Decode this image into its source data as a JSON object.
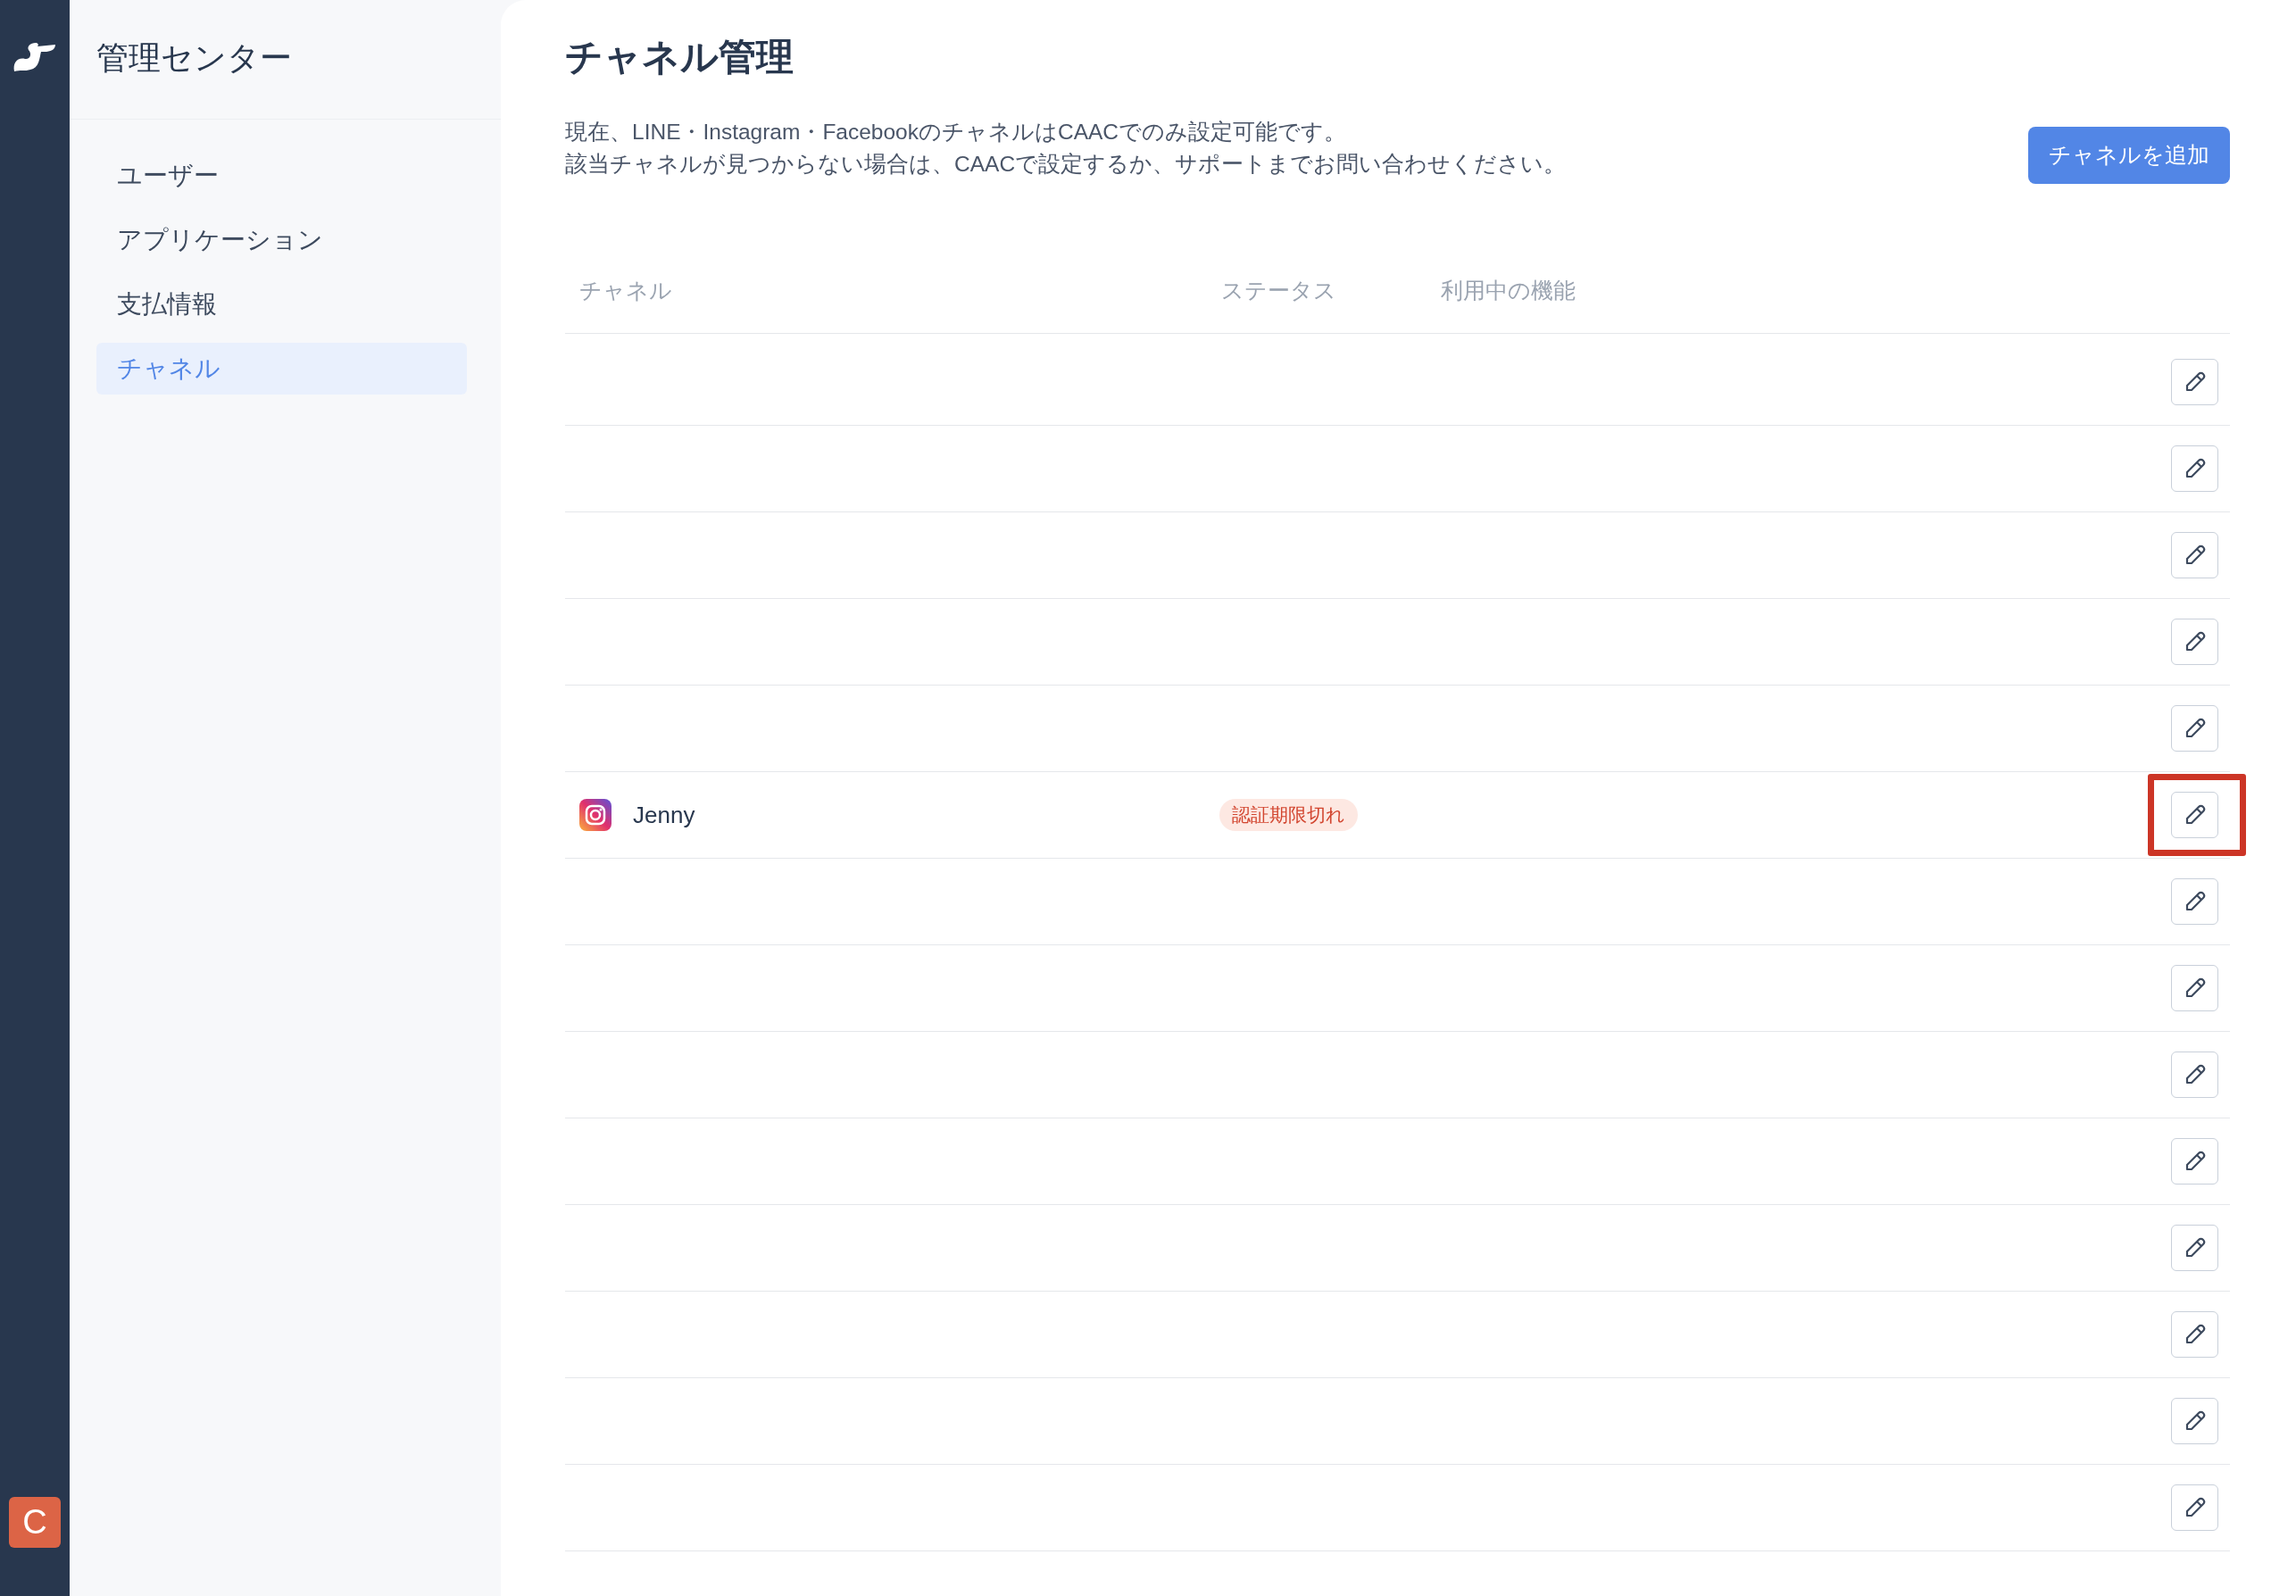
{
  "rail": {
    "avatar": "C"
  },
  "sidebar": {
    "title": "管理センター",
    "items": [
      {
        "label": "ユーザー",
        "selected": false
      },
      {
        "label": "アプリケーション",
        "selected": false
      },
      {
        "label": "支払情報",
        "selected": false
      },
      {
        "label": "チャネル",
        "selected": true
      }
    ]
  },
  "page": {
    "title": "チャネル管理",
    "description": [
      "現在、LINE・Instagram・FacebookのチャネルはCAACでのみ設定可能です。",
      "該当チャネルが見つからない場合は、CAACで設定するか、サポートまでお問い合わせください。"
    ],
    "add_button": "チャネルを追加"
  },
  "table": {
    "columns": [
      "チャネル",
      "ステータス",
      "利用中の機能"
    ],
    "rows": [
      {
        "highlighted": false
      },
      {
        "highlighted": false
      },
      {
        "highlighted": false
      },
      {
        "highlighted": false
      },
      {
        "highlighted": false
      },
      {
        "name": "Jenny",
        "status": "認証期限切れ",
        "highlighted": true
      },
      {
        "highlighted": false
      },
      {
        "highlighted": false
      },
      {
        "highlighted": false
      },
      {
        "highlighted": false
      },
      {
        "highlighted": false
      },
      {
        "highlighted": false
      },
      {
        "highlighted": false
      },
      {
        "highlighted": false
      }
    ]
  }
}
